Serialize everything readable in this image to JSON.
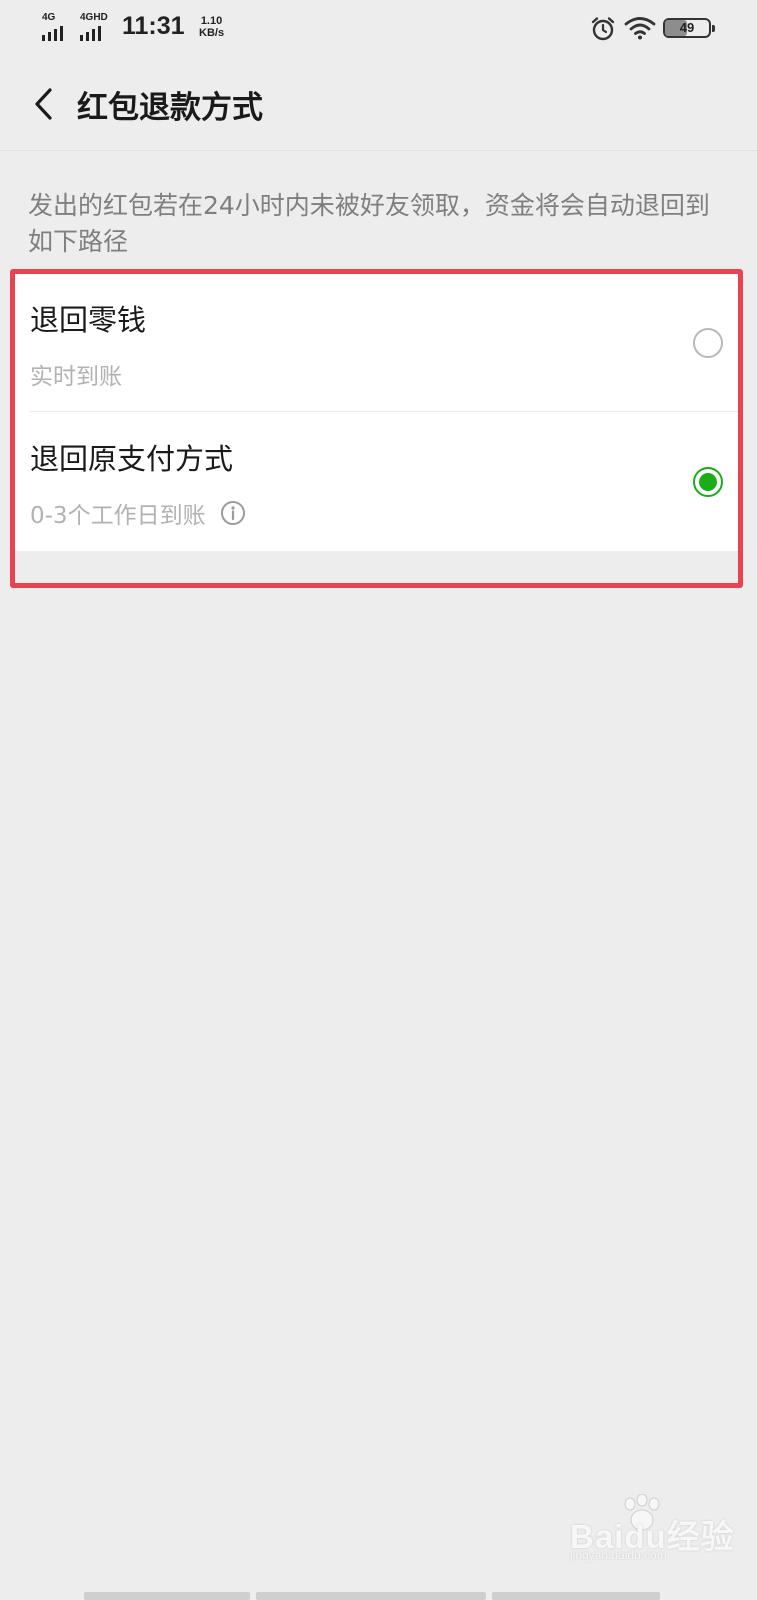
{
  "status_bar": {
    "signal_1_label": "4G",
    "signal_2_label": "4GHD",
    "time": "11:31",
    "net_speed_value": "1.10",
    "net_speed_unit": "KB/s",
    "icons": [
      "alarm-icon",
      "wifi-icon",
      "battery-icon"
    ],
    "battery_level": 49,
    "battery_text": "49"
  },
  "nav": {
    "back_icon": "chevron-left-icon",
    "title": "红包退款方式"
  },
  "description": "发出的红包若在24小时内未被好友领取，资金将会自动退回到如下路径",
  "options": [
    {
      "title": "退回零钱",
      "subtitle": "实时到账",
      "selected": false
    },
    {
      "title": "退回原支付方式",
      "subtitle": "0-3个工作日到账",
      "info_icon": "info-icon",
      "selected": true
    }
  ],
  "colors": {
    "accent_green": "#1aad19",
    "highlight_red": "#e94250",
    "background": "#ededed"
  },
  "watermark": {
    "logo_text": "Baidu经验",
    "url": "jingyan.baidu.com"
  }
}
